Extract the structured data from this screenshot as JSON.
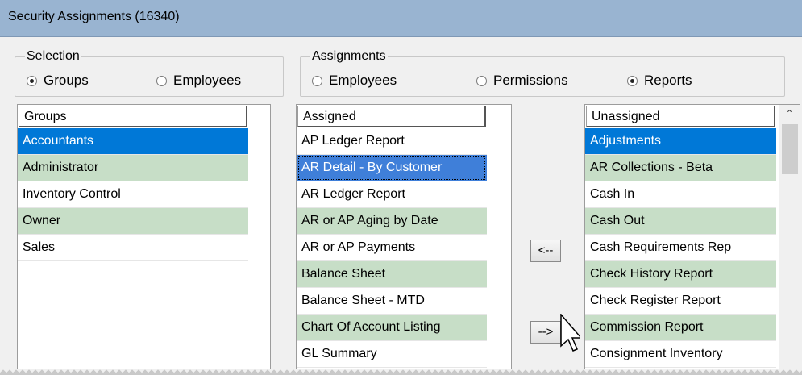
{
  "window": {
    "title": "Security Assignments (16340)"
  },
  "selection": {
    "legend": "Selection",
    "options": [
      {
        "label": "Groups",
        "checked": true
      },
      {
        "label": "Employees",
        "checked": false
      }
    ]
  },
  "assignments": {
    "legend": "Assignments",
    "options": [
      {
        "label": "Employees",
        "checked": false
      },
      {
        "label": "Permissions",
        "checked": false
      },
      {
        "label": "Reports",
        "checked": true
      }
    ]
  },
  "groups_list": {
    "header": "Groups",
    "items": [
      "Accountants",
      "Administrator",
      "Inventory Control",
      "Owner",
      "Sales"
    ]
  },
  "assigned_list": {
    "header": "Assigned",
    "items": [
      "AP Ledger Report",
      "AR Detail - By Customer",
      "AR Ledger Report",
      "AR or AP Aging by Date",
      "AR or AP Payments",
      "Balance Sheet",
      "Balance Sheet - MTD",
      "Chart Of Account Listing",
      "GL Summary"
    ]
  },
  "unassigned_list": {
    "header": "Unassigned",
    "items": [
      "Adjustments",
      "AR Collections - Beta",
      "Cash In",
      "Cash Out",
      "Cash Requirements Rep",
      "Check History Report",
      "Check Register Report",
      "Commission Report",
      "Consignment Inventory"
    ]
  },
  "buttons": {
    "unassign": "<--",
    "assign": "-->"
  },
  "colors": {
    "selected": "#0078d7",
    "alt_row": "#c7dec7",
    "titlebar": "#99b4d1"
  }
}
